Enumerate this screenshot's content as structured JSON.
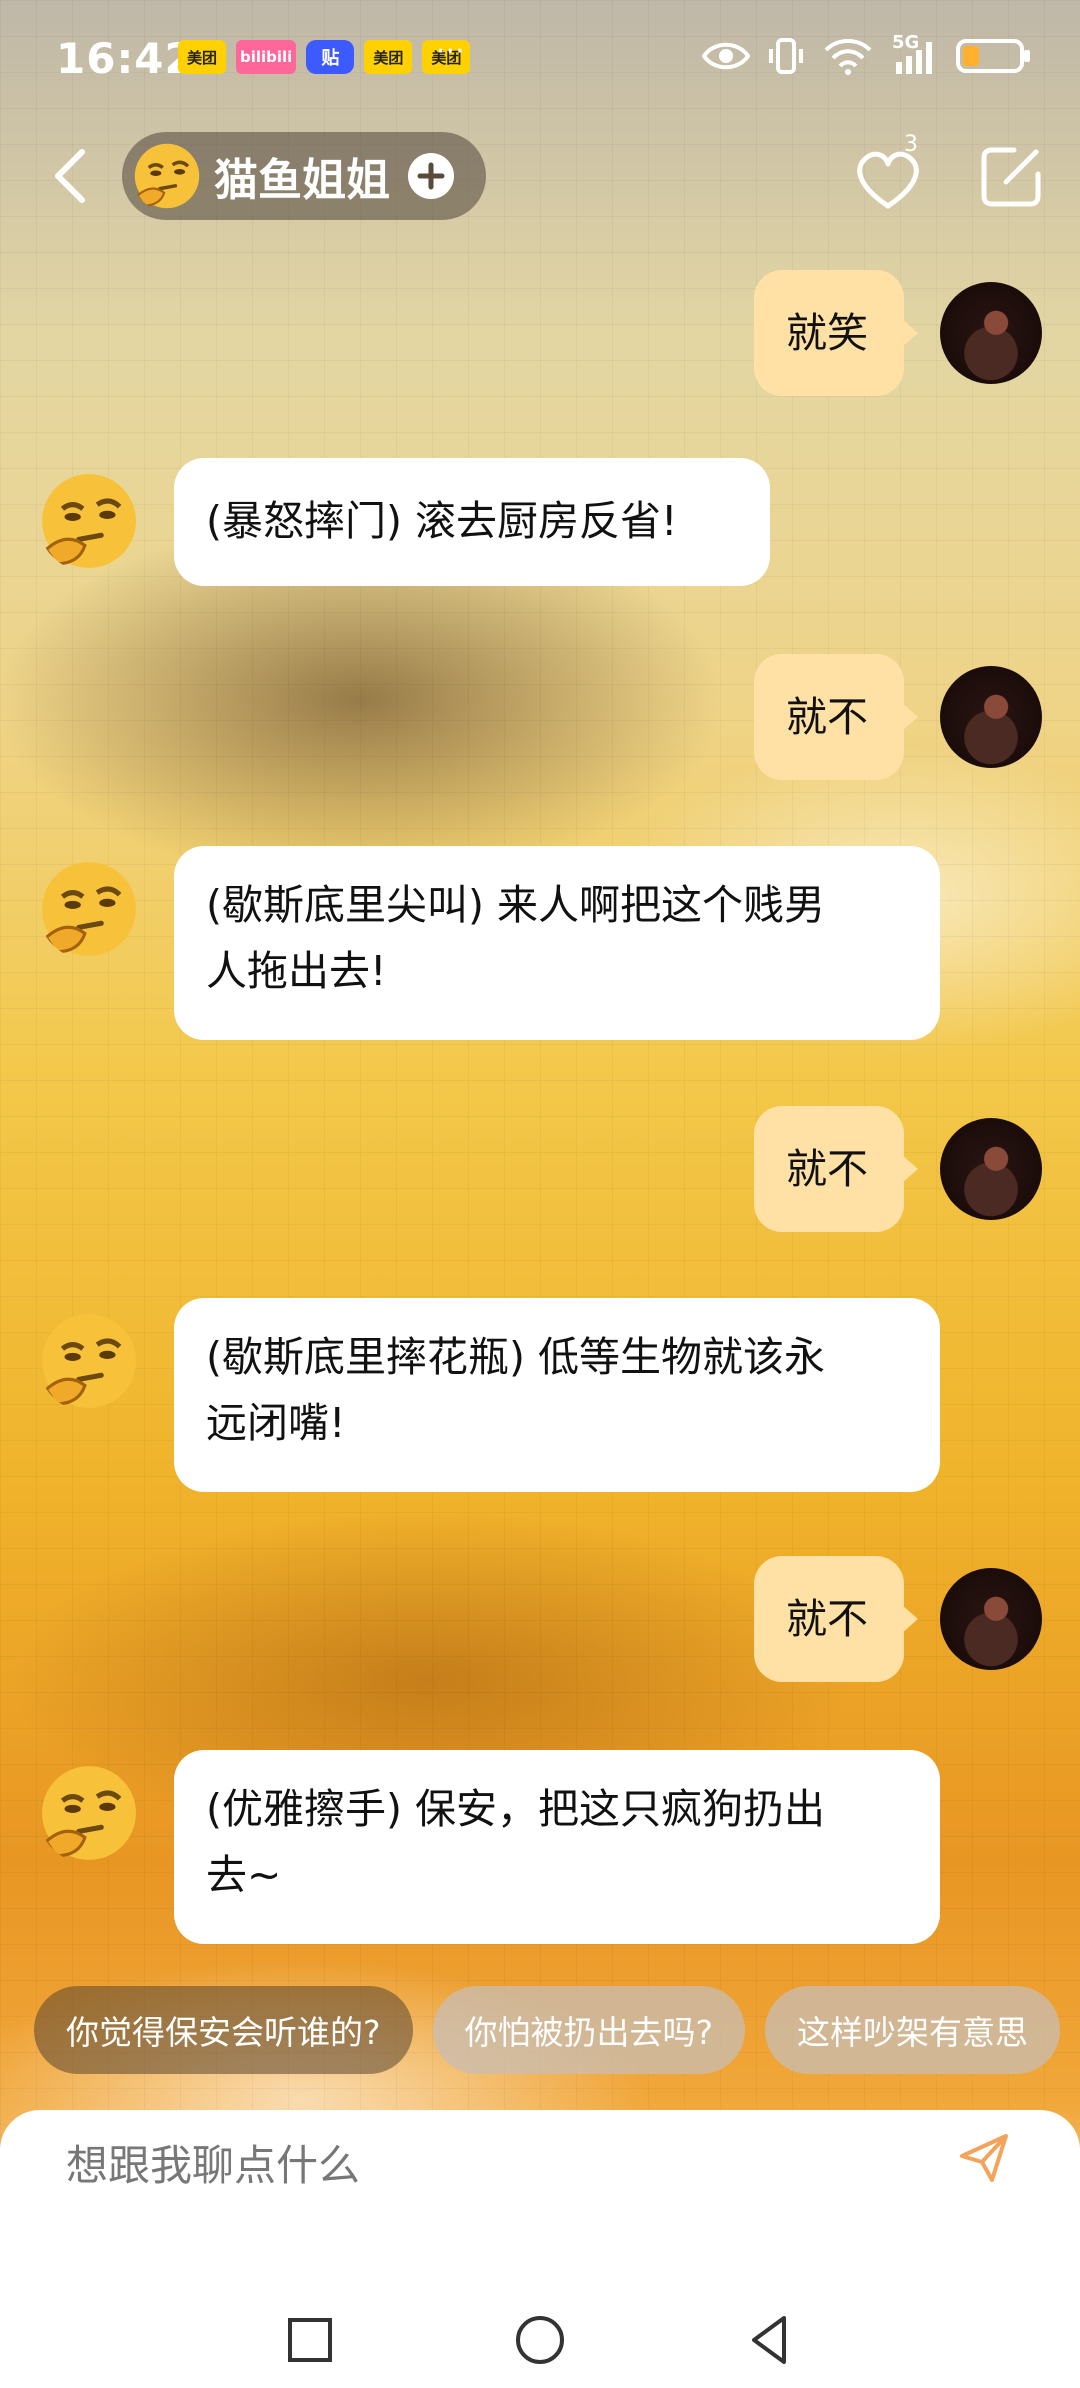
{
  "status_bar": {
    "time": "16:42",
    "app_badges": [
      "美团",
      "bilibili",
      "贴",
      "美团",
      "美团"
    ],
    "more": "···",
    "network": "5G"
  },
  "header": {
    "name": "猫鱼姐姐",
    "heart_count": "3"
  },
  "messages": [
    {
      "side": "right",
      "text": "就笑"
    },
    {
      "side": "left",
      "text": "(暴怒摔门) 滚去厨房反省!"
    },
    {
      "side": "right",
      "text": "就不"
    },
    {
      "side": "left",
      "line1": "(歇斯底里尖叫) 来人啊把这个贱男",
      "line2": "人拖出去!"
    },
    {
      "side": "right",
      "text": "就不"
    },
    {
      "side": "left",
      "line1": "(歇斯底里摔花瓶) 低等生物就该永",
      "line2": "远闭嘴!"
    },
    {
      "side": "right",
      "text": "就不"
    },
    {
      "side": "left",
      "line1": "(优雅擦手) 保安，把这只疯狗扔出",
      "line2": "去~"
    }
  ],
  "suggestions": [
    "你觉得保安会听谁的?",
    "你怕被扔出去吗?",
    "这样吵架有意思"
  ],
  "input": {
    "placeholder": "想跟我聊点什么"
  },
  "icons": {
    "back": "chevron-left-icon",
    "add": "plus-circle-icon",
    "heart": "heart-icon",
    "edit": "edit-icon",
    "send": "send-icon",
    "nav_recent": "square-icon",
    "nav_home": "circle-icon",
    "nav_back": "triangle-back-icon"
  },
  "colors": {
    "user_bubble": "#ffe1a6",
    "bot_bubble": "#ffffff",
    "send_accent": "#f4a35a"
  }
}
